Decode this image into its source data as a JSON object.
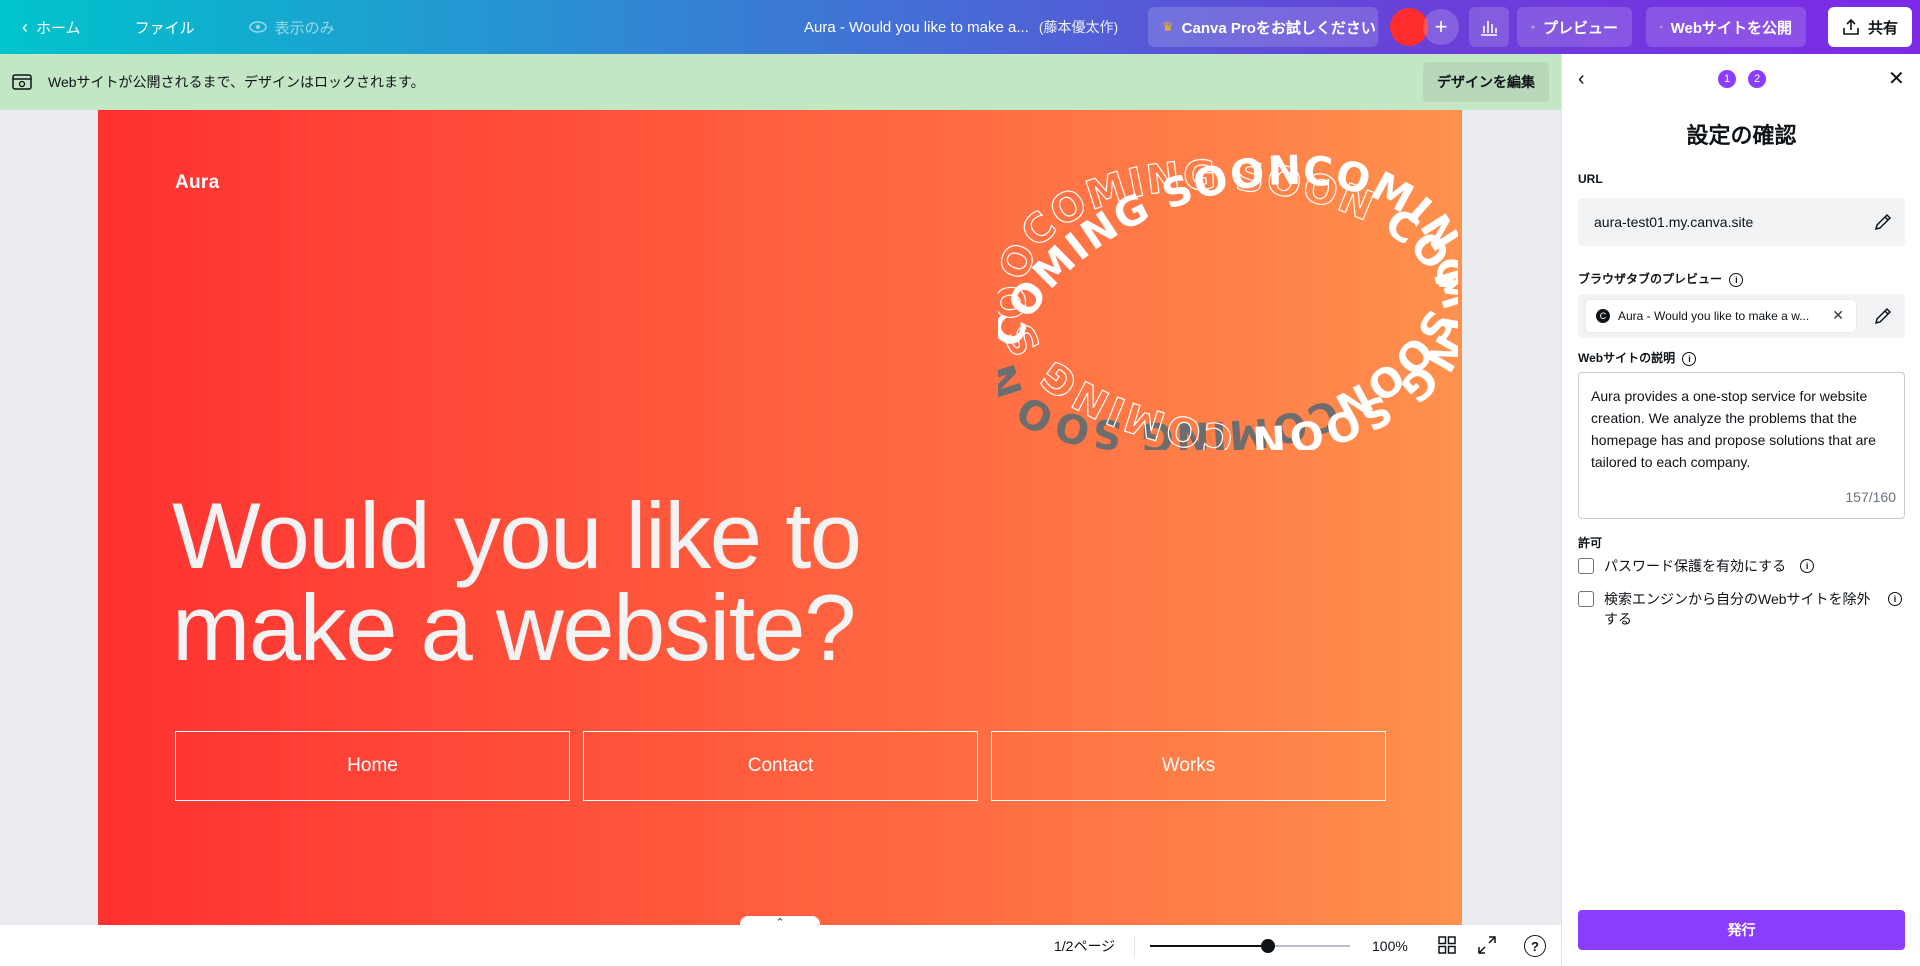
{
  "topbar": {
    "home_label": "ホーム",
    "file_label": "ファイル",
    "view_only_label": "表示のみ",
    "doc_title": "Aura - Would you like to make a...",
    "doc_owner": "(藤本優太作)",
    "pro_label": "Canva Proをお試しください",
    "preview_label": "プレビュー",
    "publish_label": "Webサイトを公開",
    "share_label": "共有"
  },
  "banner": {
    "message": "Webサイトが公開されるまで、デザインはロックされます。",
    "edit_label": "デザインを編集"
  },
  "page": {
    "logo": "Aura",
    "headline_line1": "Would you like to",
    "headline_line2": "make a website?",
    "nav": [
      "Home",
      "Contact",
      "Works"
    ],
    "coming_text": "COMING SOON"
  },
  "bottombar": {
    "page_indicator": "1/2ページ",
    "zoom": "100%",
    "zoom_level": 0.59,
    "help": "?"
  },
  "panel": {
    "steps": [
      "1",
      "2"
    ],
    "title": "設定の確認",
    "url_label": "URL",
    "url_value": "aura-test01.my.canva.site",
    "tab_preview_label": "ブラウザタブのプレビュー",
    "tab_preview_text": "Aura - Would you like to make a w...",
    "tab_favicon": "C",
    "desc_label": "Webサイトの説明",
    "desc_value": "Aura provides a one-stop service for website creation. We analyze the problems that the homepage has and propose solutions that are tailored to each company.",
    "desc_count": "157/160",
    "permission_label": "許可",
    "password_label": "パスワード保護を有効にする",
    "search_exclude_label": "検索エンジンから自分のWebサイトを除外する",
    "publish_button": "発行"
  },
  "colors": {
    "accent": "#8b3dff",
    "page_gradient_start": "#ff3131",
    "page_gradient_end": "#ff914d",
    "banner_bg": "#c3e6c5"
  }
}
